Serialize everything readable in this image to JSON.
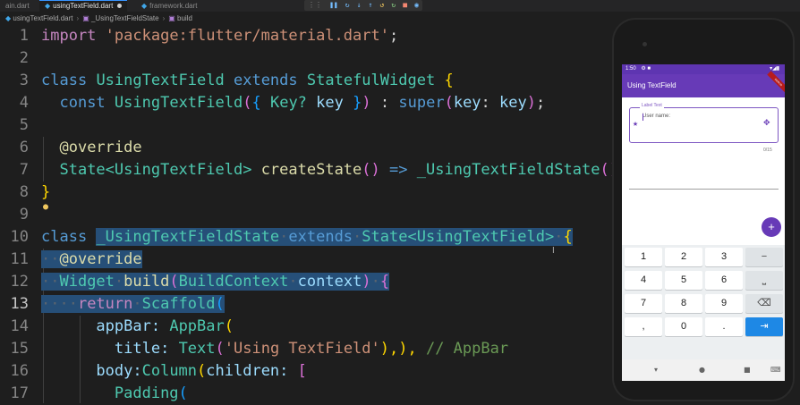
{
  "tabs": [
    {
      "label": "ain.dart"
    },
    {
      "label": "usingTextField.dart"
    },
    {
      "label": "framework.dart"
    }
  ],
  "debug_toolbar": [
    "⋮⋮",
    "❚❚",
    "↻",
    "↓",
    "↑",
    "↺",
    "↻",
    "■",
    "◉"
  ],
  "breadcrumb": {
    "file": "usingTextField.dart",
    "class": "_UsingTextFieldState",
    "method": "build"
  },
  "editor": {
    "line_numbers": [
      "1",
      "2",
      "3",
      "4",
      "5",
      "6",
      "7",
      "8",
      "9",
      "10",
      "11",
      "12",
      "13",
      "14",
      "15",
      "16",
      "17"
    ],
    "current_line": "13"
  },
  "code": {
    "l1_import": "import",
    "l1_str": "'package:flutter/material.dart'",
    "l1_end": ";",
    "l3_class": "class",
    "l3_name": "UsingTextField",
    "l3_extends": "extends",
    "l3_parent": "StatefulWidget",
    "l3_brace": "{",
    "l4_const": "const",
    "l4_ctor": "UsingTextField",
    "l4_p1": "(",
    "l4_b1": "{",
    "l4_type": "Key?",
    "l4_key": "key",
    "l4_b2": "}",
    "l4_p2": ")",
    "l4_colon": ":",
    "l4_super": "super",
    "l4_p3": "(",
    "l4_named": "key",
    "l4_colon2": ":",
    "l4_val": "key",
    "l4_p4": ")",
    "l4_end": ";",
    "l6_ann": "@override",
    "l7_state": "State",
    "l7_generic": "<UsingTextField>",
    "l7_method": "createState",
    "l7_paren": "()",
    "l7_arrow": "=>",
    "l7_ret": "_UsingTextFieldState",
    "l7_paren2": "()",
    "l8_brace": "}",
    "l10_class": "class",
    "l10_name": "_UsingTextFieldState",
    "l10_extends": "extends",
    "l10_state": "State",
    "l10_generic": "<UsingTextField>",
    "l10_brace": "{",
    "l11_ann": "@override",
    "l12_type": "Widget",
    "l12_method": "build",
    "l12_paren": "(",
    "l12_ptype": "BuildContext",
    "l12_pname": "context",
    "l12_paren2": ")",
    "l12_brace": "{",
    "l13_return": "return",
    "l13_scaffold": "Scaffold",
    "l13_paren": "(",
    "l14_prop": "appBar:",
    "l14_appbar": "AppBar",
    "l14_paren": "(",
    "l15_prop": "title:",
    "l15_text": "Text",
    "l15_paren": "(",
    "l15_str": "'Using TextField'",
    "l15_close": "),),",
    "l15_comment": "// AppBar",
    "l16_prop": "body:",
    "l16_column": "Column",
    "l16_paren": "(",
    "l16_children": "children:",
    "l16_bracket": "[",
    "l17_padding": "Padding",
    "l17_paren": "("
  },
  "phone": {
    "status_time": "1:50",
    "status_icons": "⚙ ■",
    "status_right": "▾◢▮",
    "debug_ribbon": "DEBUG",
    "app_title": "Using TextField",
    "field_label": "Label Text",
    "field_hint": "User name:",
    "field_prefix_icon": "★",
    "field_suffix_icon": "✥",
    "counter": "0/15",
    "fab_icon": "+",
    "keyboard_rows": [
      [
        "1",
        "2",
        "3",
        "−"
      ],
      [
        "4",
        "5",
        "6",
        "⎵"
      ],
      [
        "7",
        "8",
        "9",
        "⌫"
      ],
      [
        ",",
        "0",
        ".",
        "⇥"
      ]
    ],
    "nav": [
      "▾",
      "●",
      "■",
      "⌨"
    ]
  },
  "colors": {
    "editor_bg": "#1e1e1e",
    "selection": "#264f78",
    "keyword": "#569cd6",
    "string": "#ce9178",
    "type": "#4ec9b0",
    "function": "#dcdcaa",
    "app_primary": "#673ab7",
    "key_action": "#1e88e5"
  }
}
